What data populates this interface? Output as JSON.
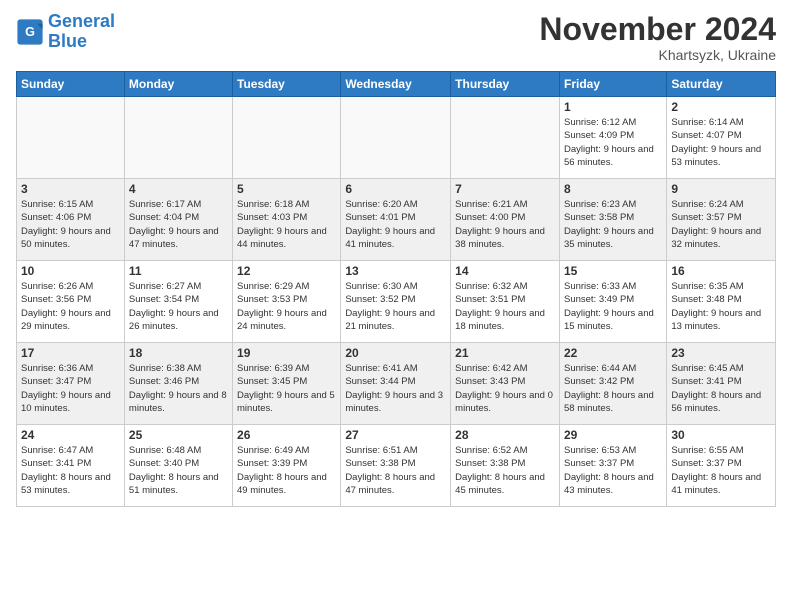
{
  "logo": {
    "line1": "General",
    "line2": "Blue"
  },
  "title": "November 2024",
  "subtitle": "Khartsyzk, Ukraine",
  "days_of_week": [
    "Sunday",
    "Monday",
    "Tuesday",
    "Wednesday",
    "Thursday",
    "Friday",
    "Saturday"
  ],
  "weeks": [
    [
      {
        "day": "",
        "info": ""
      },
      {
        "day": "",
        "info": ""
      },
      {
        "day": "",
        "info": ""
      },
      {
        "day": "",
        "info": ""
      },
      {
        "day": "",
        "info": ""
      },
      {
        "day": "1",
        "info": "Sunrise: 6:12 AM\nSunset: 4:09 PM\nDaylight: 9 hours and 56 minutes."
      },
      {
        "day": "2",
        "info": "Sunrise: 6:14 AM\nSunset: 4:07 PM\nDaylight: 9 hours and 53 minutes."
      }
    ],
    [
      {
        "day": "3",
        "info": "Sunrise: 6:15 AM\nSunset: 4:06 PM\nDaylight: 9 hours and 50 minutes."
      },
      {
        "day": "4",
        "info": "Sunrise: 6:17 AM\nSunset: 4:04 PM\nDaylight: 9 hours and 47 minutes."
      },
      {
        "day": "5",
        "info": "Sunrise: 6:18 AM\nSunset: 4:03 PM\nDaylight: 9 hours and 44 minutes."
      },
      {
        "day": "6",
        "info": "Sunrise: 6:20 AM\nSunset: 4:01 PM\nDaylight: 9 hours and 41 minutes."
      },
      {
        "day": "7",
        "info": "Sunrise: 6:21 AM\nSunset: 4:00 PM\nDaylight: 9 hours and 38 minutes."
      },
      {
        "day": "8",
        "info": "Sunrise: 6:23 AM\nSunset: 3:58 PM\nDaylight: 9 hours and 35 minutes."
      },
      {
        "day": "9",
        "info": "Sunrise: 6:24 AM\nSunset: 3:57 PM\nDaylight: 9 hours and 32 minutes."
      }
    ],
    [
      {
        "day": "10",
        "info": "Sunrise: 6:26 AM\nSunset: 3:56 PM\nDaylight: 9 hours and 29 minutes."
      },
      {
        "day": "11",
        "info": "Sunrise: 6:27 AM\nSunset: 3:54 PM\nDaylight: 9 hours and 26 minutes."
      },
      {
        "day": "12",
        "info": "Sunrise: 6:29 AM\nSunset: 3:53 PM\nDaylight: 9 hours and 24 minutes."
      },
      {
        "day": "13",
        "info": "Sunrise: 6:30 AM\nSunset: 3:52 PM\nDaylight: 9 hours and 21 minutes."
      },
      {
        "day": "14",
        "info": "Sunrise: 6:32 AM\nSunset: 3:51 PM\nDaylight: 9 hours and 18 minutes."
      },
      {
        "day": "15",
        "info": "Sunrise: 6:33 AM\nSunset: 3:49 PM\nDaylight: 9 hours and 15 minutes."
      },
      {
        "day": "16",
        "info": "Sunrise: 6:35 AM\nSunset: 3:48 PM\nDaylight: 9 hours and 13 minutes."
      }
    ],
    [
      {
        "day": "17",
        "info": "Sunrise: 6:36 AM\nSunset: 3:47 PM\nDaylight: 9 hours and 10 minutes."
      },
      {
        "day": "18",
        "info": "Sunrise: 6:38 AM\nSunset: 3:46 PM\nDaylight: 9 hours and 8 minutes."
      },
      {
        "day": "19",
        "info": "Sunrise: 6:39 AM\nSunset: 3:45 PM\nDaylight: 9 hours and 5 minutes."
      },
      {
        "day": "20",
        "info": "Sunrise: 6:41 AM\nSunset: 3:44 PM\nDaylight: 9 hours and 3 minutes."
      },
      {
        "day": "21",
        "info": "Sunrise: 6:42 AM\nSunset: 3:43 PM\nDaylight: 9 hours and 0 minutes."
      },
      {
        "day": "22",
        "info": "Sunrise: 6:44 AM\nSunset: 3:42 PM\nDaylight: 8 hours and 58 minutes."
      },
      {
        "day": "23",
        "info": "Sunrise: 6:45 AM\nSunset: 3:41 PM\nDaylight: 8 hours and 56 minutes."
      }
    ],
    [
      {
        "day": "24",
        "info": "Sunrise: 6:47 AM\nSunset: 3:41 PM\nDaylight: 8 hours and 53 minutes."
      },
      {
        "day": "25",
        "info": "Sunrise: 6:48 AM\nSunset: 3:40 PM\nDaylight: 8 hours and 51 minutes."
      },
      {
        "day": "26",
        "info": "Sunrise: 6:49 AM\nSunset: 3:39 PM\nDaylight: 8 hours and 49 minutes."
      },
      {
        "day": "27",
        "info": "Sunrise: 6:51 AM\nSunset: 3:38 PM\nDaylight: 8 hours and 47 minutes."
      },
      {
        "day": "28",
        "info": "Sunrise: 6:52 AM\nSunset: 3:38 PM\nDaylight: 8 hours and 45 minutes."
      },
      {
        "day": "29",
        "info": "Sunrise: 6:53 AM\nSunset: 3:37 PM\nDaylight: 8 hours and 43 minutes."
      },
      {
        "day": "30",
        "info": "Sunrise: 6:55 AM\nSunset: 3:37 PM\nDaylight: 8 hours and 41 minutes."
      }
    ]
  ]
}
